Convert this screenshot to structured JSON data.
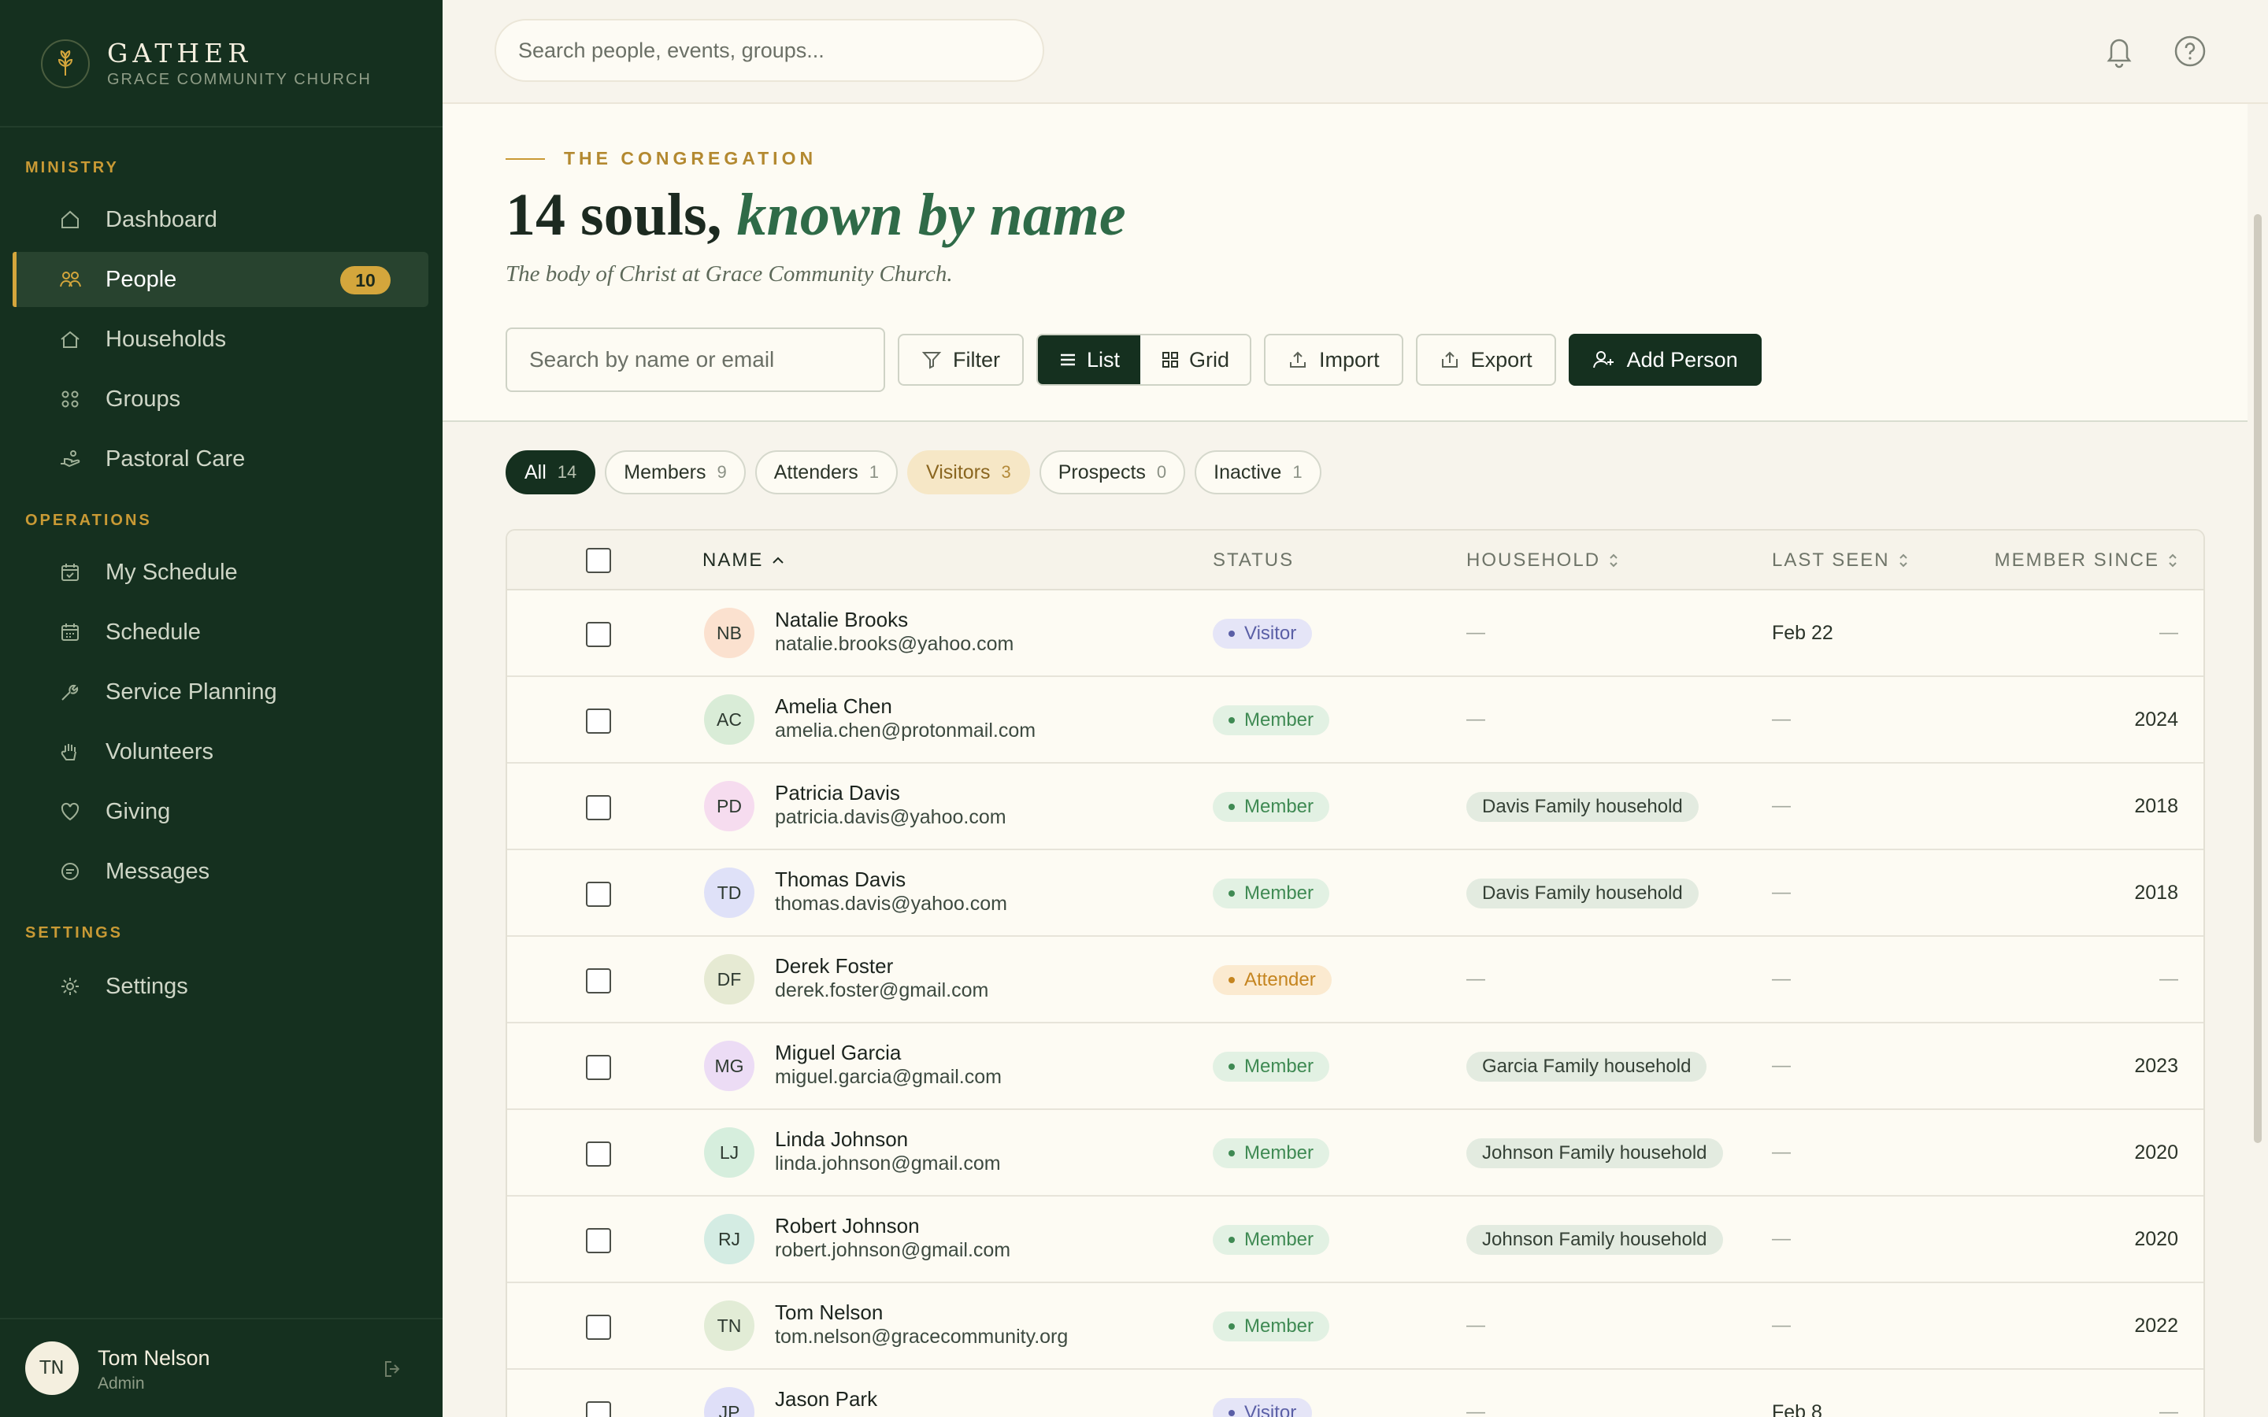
{
  "brand": {
    "name": "GATHER",
    "subtitle": "GRACE COMMUNITY CHURCH"
  },
  "sidebar": {
    "sections": {
      "ministry": "MINISTRY",
      "operations": "OPERATIONS",
      "settings": "SETTINGS"
    },
    "items": [
      {
        "label": "Dashboard",
        "icon": "home-icon"
      },
      {
        "label": "People",
        "icon": "people-icon",
        "badge": "10",
        "active": true
      },
      {
        "label": "Households",
        "icon": "household-icon"
      },
      {
        "label": "Groups",
        "icon": "groups-icon"
      },
      {
        "label": "Pastoral Care",
        "icon": "care-icon"
      },
      {
        "label": "My Schedule",
        "icon": "calendar-check-icon"
      },
      {
        "label": "Schedule",
        "icon": "calendar-icon"
      },
      {
        "label": "Service Planning",
        "icon": "tools-icon"
      },
      {
        "label": "Volunteers",
        "icon": "hand-icon"
      },
      {
        "label": "Giving",
        "icon": "heart-icon"
      },
      {
        "label": "Messages",
        "icon": "message-icon"
      },
      {
        "label": "Settings",
        "icon": "gear-icon"
      }
    ],
    "user": {
      "initials": "TN",
      "name": "Tom Nelson",
      "role": "Admin"
    }
  },
  "topbar": {
    "search_placeholder": "Search people, events, groups..."
  },
  "header": {
    "eyebrow": "THE CONGREGATION",
    "title_main": "14 souls, ",
    "title_accent": "known by name",
    "subtitle": "The body of Christ at Grace Community Church."
  },
  "toolbar": {
    "search_placeholder": "Search by name or email",
    "filter_label": "Filter",
    "list_label": "List",
    "grid_label": "Grid",
    "import_label": "Import",
    "export_label": "Export",
    "add_label": "Add Person"
  },
  "chips": [
    {
      "label": "All",
      "count": "14"
    },
    {
      "label": "Members",
      "count": "9"
    },
    {
      "label": "Attenders",
      "count": "1"
    },
    {
      "label": "Visitors",
      "count": "3"
    },
    {
      "label": "Prospects",
      "count": "0"
    },
    {
      "label": "Inactive",
      "count": "1"
    }
  ],
  "table": {
    "columns": {
      "name": "NAME",
      "status": "STATUS",
      "household": "HOUSEHOLD",
      "last_seen": "LAST SEEN",
      "member_since": "MEMBER SINCE"
    },
    "dash": "—",
    "rows": [
      {
        "initials": "NB",
        "name": "Natalie Brooks",
        "email": "natalie.brooks@yahoo.com",
        "status": "Visitor",
        "household": "",
        "last_seen": "Feb 22",
        "since": "",
        "avatar_bg": "#fbe1cf"
      },
      {
        "initials": "AC",
        "name": "Amelia Chen",
        "email": "amelia.chen@protonmail.com",
        "status": "Member",
        "household": "",
        "last_seen": "",
        "since": "2024",
        "avatar_bg": "#d9ecd7"
      },
      {
        "initials": "PD",
        "name": "Patricia Davis",
        "email": "patricia.davis@yahoo.com",
        "status": "Member",
        "household": "Davis Family household",
        "last_seen": "",
        "since": "2018",
        "avatar_bg": "#f6dcef"
      },
      {
        "initials": "TD",
        "name": "Thomas Davis",
        "email": "thomas.davis@yahoo.com",
        "status": "Member",
        "household": "Davis Family household",
        "last_seen": "",
        "since": "2018",
        "avatar_bg": "#dfe1f8"
      },
      {
        "initials": "DF",
        "name": "Derek Foster",
        "email": "derek.foster@gmail.com",
        "status": "Attender",
        "household": "",
        "last_seen": "",
        "since": "",
        "avatar_bg": "#e6ead3"
      },
      {
        "initials": "MG",
        "name": "Miguel Garcia",
        "email": "miguel.garcia@gmail.com",
        "status": "Member",
        "household": "Garcia Family household",
        "last_seen": "",
        "since": "2023",
        "avatar_bg": "#ecdcf5"
      },
      {
        "initials": "LJ",
        "name": "Linda Johnson",
        "email": "linda.johnson@gmail.com",
        "status": "Member",
        "household": "Johnson Family household",
        "last_seen": "",
        "since": "2020",
        "avatar_bg": "#d6eedd"
      },
      {
        "initials": "RJ",
        "name": "Robert Johnson",
        "email": "robert.johnson@gmail.com",
        "status": "Member",
        "household": "Johnson Family household",
        "last_seen": "",
        "since": "2020",
        "avatar_bg": "#d4ece3"
      },
      {
        "initials": "TN",
        "name": "Tom Nelson",
        "email": "tom.nelson@gracecommunity.org",
        "status": "Member",
        "household": "",
        "last_seen": "",
        "since": "2022",
        "avatar_bg": "#e2ecd6"
      },
      {
        "initials": "JP",
        "name": "Jason Park",
        "email": "",
        "status": "Visitor",
        "household": "",
        "last_seen": "Feb 8",
        "since": "",
        "avatar_bg": "#dfdff8"
      }
    ]
  },
  "colors": {
    "sidebar_bg": "#15301f",
    "accent_gold": "#d4a63c",
    "accent_green": "#2f6b48"
  }
}
